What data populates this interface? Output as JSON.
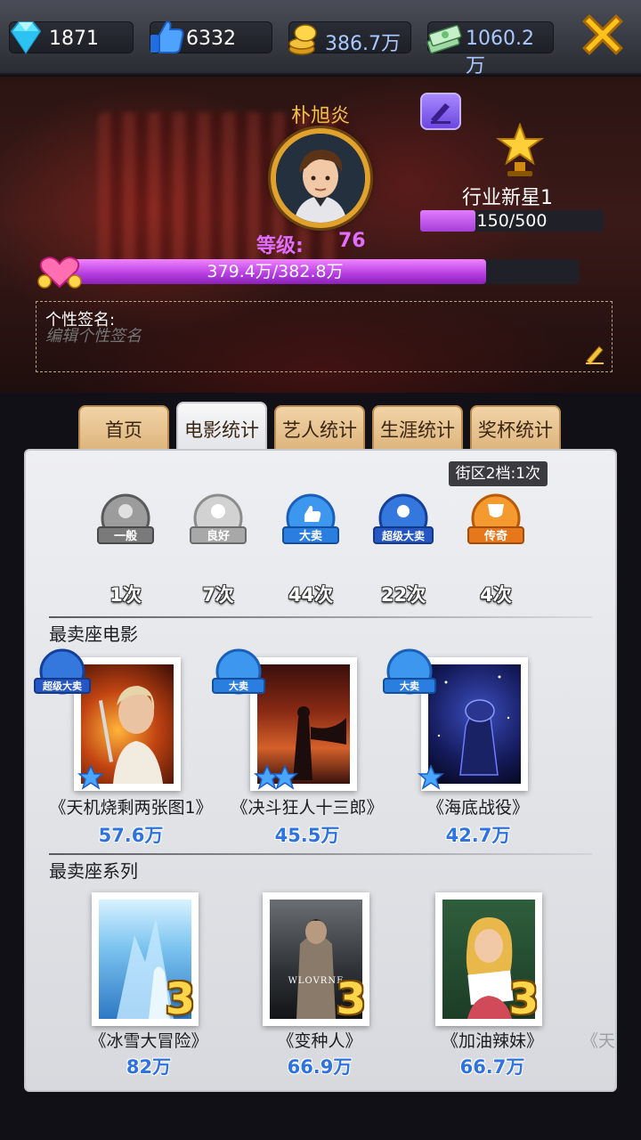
{
  "resources": {
    "diamonds": "1871",
    "likes": "6332",
    "gold": "386.7万",
    "cash": "1060.2万"
  },
  "profile": {
    "name": "朴旭炎",
    "level_label": "等级:",
    "level_value": "76",
    "rank_title": "行业新星1",
    "rank_progress_text": "150/500",
    "rank_progress_fraction": 0.3,
    "exp_text": "379.4万/382.8万",
    "exp_fraction": 0.82,
    "signature_label": "个性签名:",
    "signature_placeholder": "编辑个性签名"
  },
  "tabs": [
    {
      "label": "首页",
      "active": false
    },
    {
      "label": "电影统计",
      "active": true
    },
    {
      "label": "艺人统计",
      "active": false
    },
    {
      "label": "生涯统计",
      "active": false
    },
    {
      "label": "奖杯统计",
      "active": false
    }
  ],
  "stats": {
    "district_label": "街区2档:1次",
    "grades": [
      {
        "badge_text": "一般",
        "count": "1次",
        "color": "#8c8c8c"
      },
      {
        "badge_text": "良好",
        "count": "7次",
        "color": "#b4b4b4"
      },
      {
        "badge_text": "大卖",
        "count": "44次",
        "color": "#2f86e6"
      },
      {
        "badge_text": "超级大卖",
        "count": "22次",
        "color": "#2a63d4"
      },
      {
        "badge_text": "传奇",
        "count": "4次",
        "color": "#f28a1e"
      }
    ]
  },
  "best_movies": {
    "title": "最卖座电影",
    "items": [
      {
        "badge_text": "超级大卖",
        "title": "《天机烧剩两张图1》",
        "amount": "57.6万",
        "stars": 1
      },
      {
        "badge_text": "大卖",
        "title": "《决斗狂人十三郎》",
        "amount": "45.5万",
        "stars": 2
      },
      {
        "badge_text": "大卖",
        "title": "《海底战役》",
        "amount": "42.7万",
        "stars": 1
      }
    ]
  },
  "best_series": {
    "title": "最卖座系列",
    "items": [
      {
        "title": "《冰雪大冒险》",
        "amount": "82万",
        "sequel": "3",
        "poster_text": ""
      },
      {
        "title": "《变种人》",
        "amount": "66.9万",
        "sequel": "3",
        "poster_text": "WLOVRNE"
      },
      {
        "title": "《加油辣妹》",
        "amount": "66.7万",
        "sequel": "3",
        "poster_text": ""
      }
    ],
    "overflow_hint": "《天"
  },
  "colors": {
    "accent_gold": "#f2c04a",
    "level_purple": "#e36dff",
    "amount_blue": "#2e73e0",
    "tab_tan": "#dcb47c"
  },
  "icons": [
    "diamond-icon",
    "thumbs-up-icon",
    "gold-coins-icon",
    "cash-stack-icon",
    "close-icon",
    "edit-icon",
    "trophy-icon",
    "heart-icon",
    "star-icon"
  ]
}
